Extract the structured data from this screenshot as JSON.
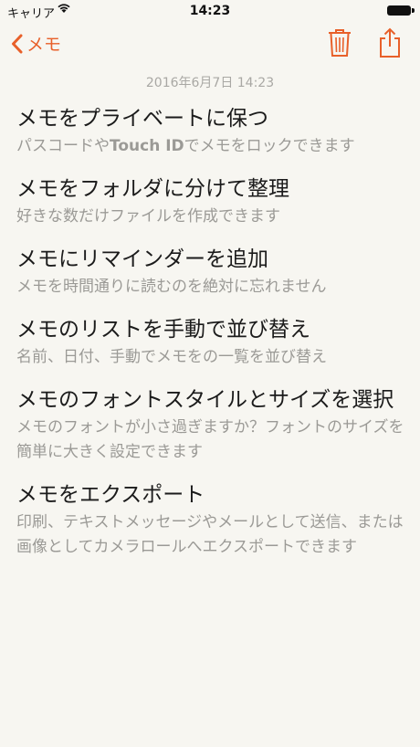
{
  "status": {
    "carrier": "キャリア",
    "time": "14:23"
  },
  "nav": {
    "back_label": "メモ"
  },
  "date": "2016年6月7日 14:23",
  "notes": [
    {
      "title": "メモをプライベートに保つ",
      "desc_pre": "パスコードや",
      "desc_bold": "Touch ID",
      "desc_post": "でメモをロックできます"
    },
    {
      "title": "メモをフォルダに分けて整理",
      "desc": "好きな数だけファイルを作成できます"
    },
    {
      "title": "メモにリマインダーを追加",
      "desc": "メモを時間通りに読むのを絶対に忘れません"
    },
    {
      "title": "メモのリストを手動で並び替え",
      "desc": "名前、日付、手動でメモをの一覧を並び替え"
    },
    {
      "title": "メモのフォントスタイルとサイズを選択",
      "desc": "メモのフォントが小さ過ぎますか？フォントのサイズを簡単に大きく設定できます"
    },
    {
      "title": "メモをエクスポート",
      "desc": "印刷、テキストメッセージやメールとして送信、または画像としてカメラロールへエクスポートできます"
    }
  ],
  "colors": {
    "accent": "#e8602a",
    "background": "#f7f6f1",
    "secondary_text": "#9b9a96"
  }
}
